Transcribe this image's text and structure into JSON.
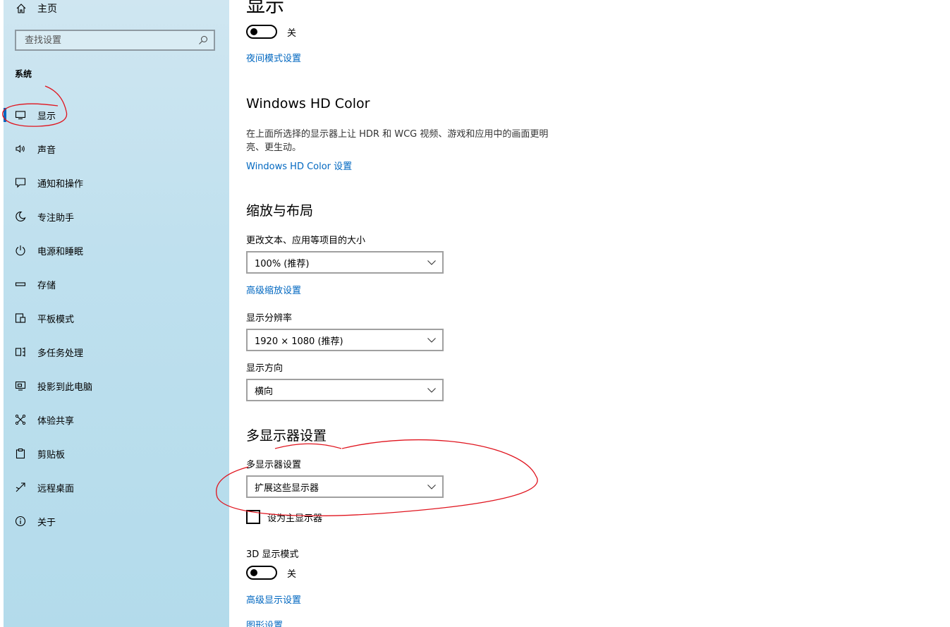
{
  "sidebar": {
    "home_label": "主页",
    "search_placeholder": "查找设置",
    "section_title": "系统",
    "items": [
      {
        "label": "显示",
        "icon": "monitor-icon"
      },
      {
        "label": "声音",
        "icon": "speaker-icon"
      },
      {
        "label": "通知和操作",
        "icon": "notification-icon"
      },
      {
        "label": "专注助手",
        "icon": "moon-icon"
      },
      {
        "label": "电源和睡眠",
        "icon": "power-icon"
      },
      {
        "label": "存储",
        "icon": "storage-icon"
      },
      {
        "label": "平板模式",
        "icon": "tablet-icon"
      },
      {
        "label": "多任务处理",
        "icon": "multitask-icon"
      },
      {
        "label": "投影到此电脑",
        "icon": "project-icon"
      },
      {
        "label": "体验共享",
        "icon": "share-icon"
      },
      {
        "label": "剪贴板",
        "icon": "clipboard-icon"
      },
      {
        "label": "远程桌面",
        "icon": "remote-desktop-icon"
      },
      {
        "label": "关于",
        "icon": "info-icon"
      }
    ]
  },
  "main": {
    "title": "显示",
    "night_light": {
      "state_label": "关",
      "link": "夜间模式设置"
    },
    "hd_color": {
      "heading": "Windows HD Color",
      "description": "在上面所选择的显示器上让 HDR 和 WCG 视频、游戏和应用中的画面更明亮、更生动。",
      "link": "Windows HD Color 设置"
    },
    "scale_layout": {
      "heading": "缩放与布局",
      "scale_label": "更改文本、应用等项目的大小",
      "scale_value": "100% (推荐)",
      "advanced_scale_link": "高级缩放设置",
      "resolution_label": "显示分辨率",
      "resolution_value": "1920 × 1080 (推荐)",
      "orientation_label": "显示方向",
      "orientation_value": "横向"
    },
    "multi_display": {
      "heading": "多显示器设置",
      "label": "多显示器设置",
      "value": "扩展这些显示器",
      "main_display_checkbox": "设为主显示器"
    },
    "display_3d": {
      "label": "3D 显示模式",
      "state_label": "关",
      "advanced_link": "高级显示设置",
      "graphics_link": "图形设置"
    }
  },
  "colors": {
    "accent": "#0067c0",
    "annotation": "#e0141e"
  }
}
